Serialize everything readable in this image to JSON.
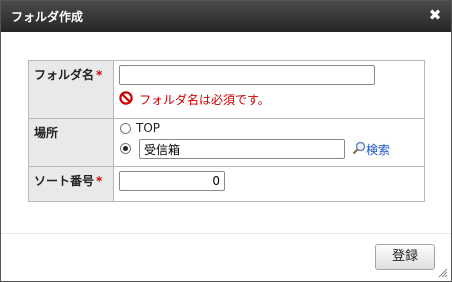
{
  "dialog": {
    "title": "フォルダ作成",
    "close_glyph": "✖"
  },
  "form": {
    "folder_name": {
      "label": "フォルダ名",
      "required_mark": "*",
      "value": "",
      "error": "フォルダ名は必須です。"
    },
    "location": {
      "label": "場所",
      "options": [
        {
          "label": "TOP",
          "selected": false
        },
        {
          "label": "",
          "value": "受信箱",
          "selected": true
        }
      ],
      "search_label": "検索"
    },
    "sort_number": {
      "label": "ソート番号",
      "required_mark": "*",
      "value": "0"
    }
  },
  "footer": {
    "register_label": "登録"
  },
  "colors": {
    "error": "#cc0000",
    "link": "#1a55c5",
    "titlebar": "#333333",
    "header_cell": "#e9e9e9"
  }
}
